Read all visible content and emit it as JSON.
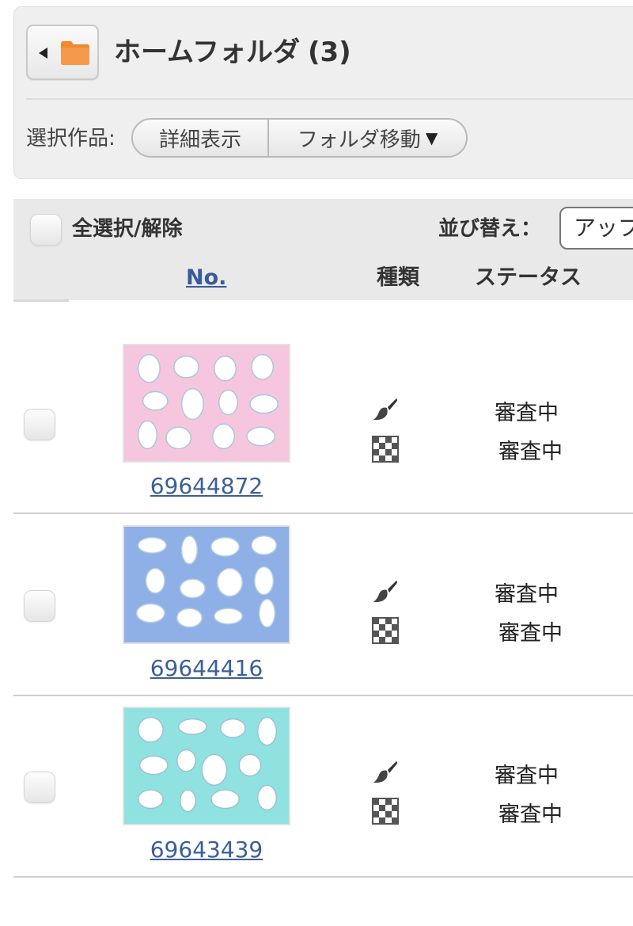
{
  "header": {
    "title": "ホームフォルダ",
    "count": "(3)",
    "back_icon": "back-arrow-icon",
    "folder_icon": "folder-icon",
    "folder_color": "#f08a2c"
  },
  "selection_bar": {
    "label": "選択作品:",
    "detail_button": "詳細表示",
    "move_button": "フォルダ移動",
    "move_caret": "▼"
  },
  "list_header": {
    "select_all_label": "全選択/解除",
    "sort_label": "並び替え：",
    "sort_value": "アップ",
    "col_no": "No.",
    "col_kind": "種類",
    "col_status": "ステータス"
  },
  "items": [
    {
      "number": "69644872",
      "thumb_color": "#f6c6df",
      "status_1": "審査中",
      "status_2": "審査中"
    },
    {
      "number": "69644416",
      "thumb_color": "#8fb0e6",
      "status_1": "審査中",
      "status_2": "審査中"
    },
    {
      "number": "69643439",
      "thumb_color": "#8fe2df",
      "status_1": "審査中",
      "status_2": "審査中"
    }
  ]
}
